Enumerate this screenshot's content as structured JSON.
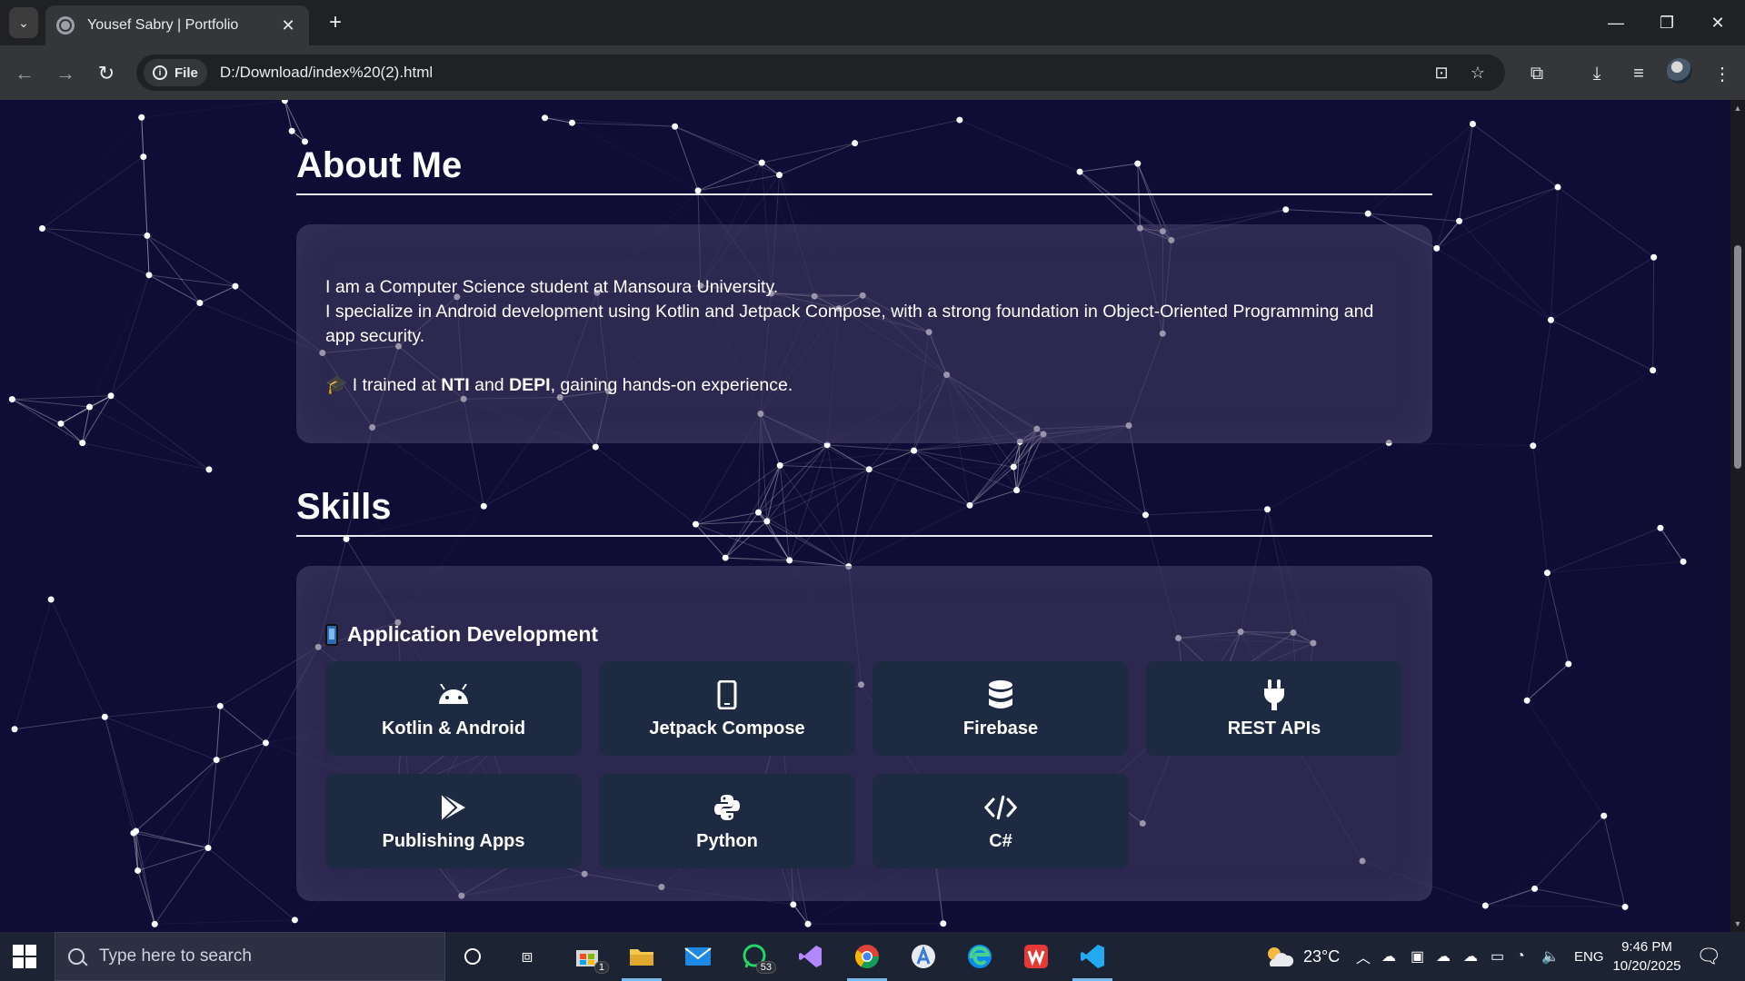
{
  "browser": {
    "tab_title": "Yousef Sabry | Portfolio",
    "tab_close": "✕",
    "new_tab": "+",
    "address_chip": "File",
    "url": "D:/Download/index%20(2).html"
  },
  "page": {
    "about": {
      "heading": "About Me",
      "line1": "I am a Computer Science student at Mansoura University.",
      "line2": "I specialize in Android development using Kotlin and Jetpack Compose, with a strong foundation in Object-Oriented Programming and app security.",
      "trained_emoji": "🎓",
      "trained_prefix": "I trained at ",
      "org1": "NTI",
      "and": " and ",
      "org2": "DEPI",
      "trained_suffix": ", gaining hands-on experience."
    },
    "skills": {
      "heading": "Skills",
      "category": "Application Development",
      "items": [
        {
          "label": "Kotlin & Android",
          "icon": "android-icon"
        },
        {
          "label": "Jetpack Compose",
          "icon": "mobile-icon"
        },
        {
          "label": "Firebase",
          "icon": "database-icon"
        },
        {
          "label": "REST APIs",
          "icon": "plug-icon"
        },
        {
          "label": "Publishing Apps",
          "icon": "google-play-icon"
        },
        {
          "label": "Python",
          "icon": "python-icon"
        },
        {
          "label": "C#",
          "icon": "code-icon"
        }
      ]
    }
  },
  "taskbar": {
    "search_placeholder": "Type here to search",
    "mail_badge": "1",
    "whatsapp_badge": "53",
    "weather": "23°C",
    "language": "ENG",
    "time": "9:46 PM",
    "date": "10/20/2025"
  },
  "colors": {
    "page_background": "#0f0c35",
    "card": "#463f66",
    "tile": "#1e2a42"
  }
}
